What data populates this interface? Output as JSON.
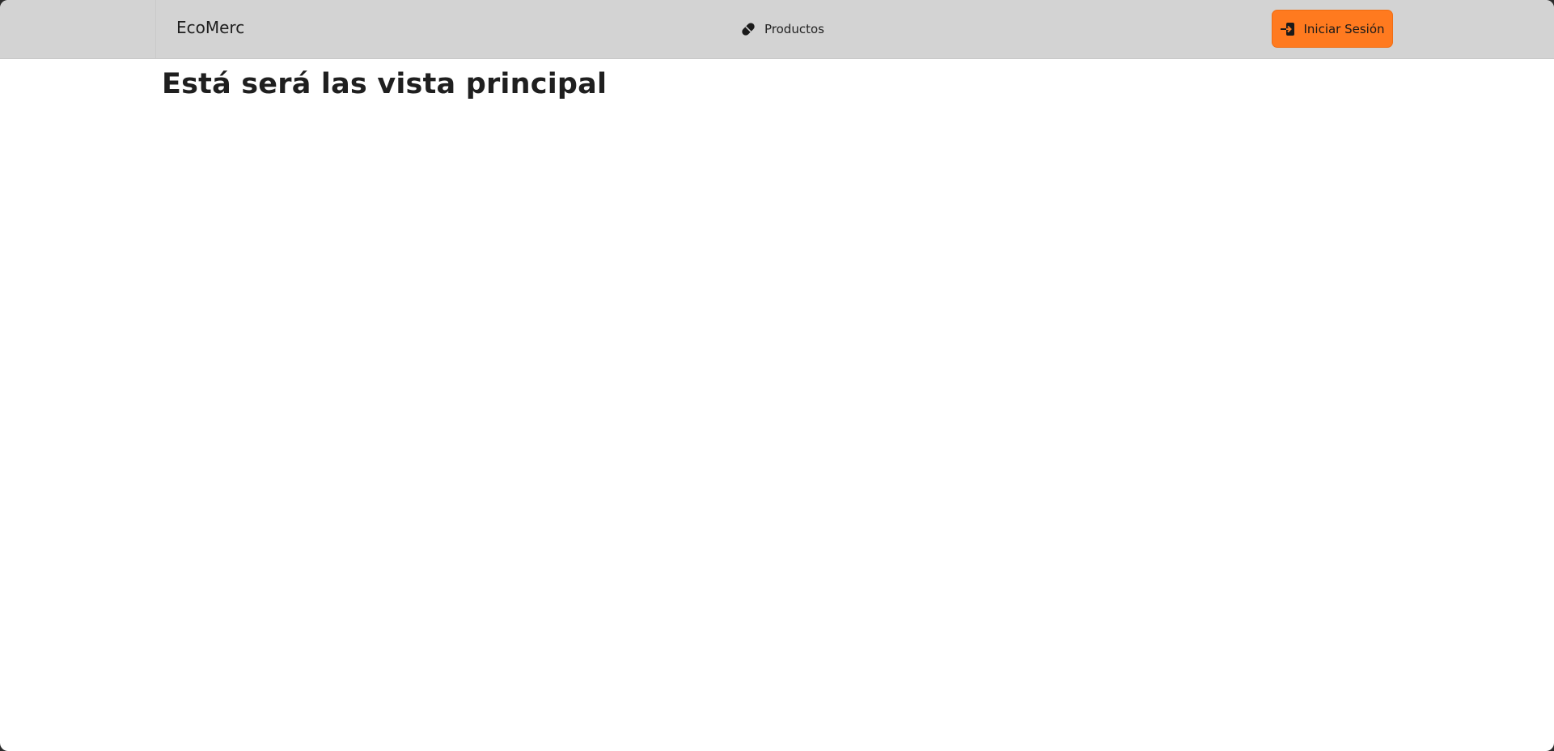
{
  "navbar": {
    "brand": "EcoMerc",
    "products_link": {
      "label": "Productos",
      "icon": "pill-icon"
    },
    "login_button": {
      "label": "Iniciar Sesión",
      "icon": "sign-in-icon"
    }
  },
  "main": {
    "title": "Está será las vista principal"
  },
  "colors": {
    "navbar_bg": "#d3d3d3",
    "accent": "#ff7a1f",
    "page_bg": "#ffffff",
    "text": "#1f1f1f"
  }
}
